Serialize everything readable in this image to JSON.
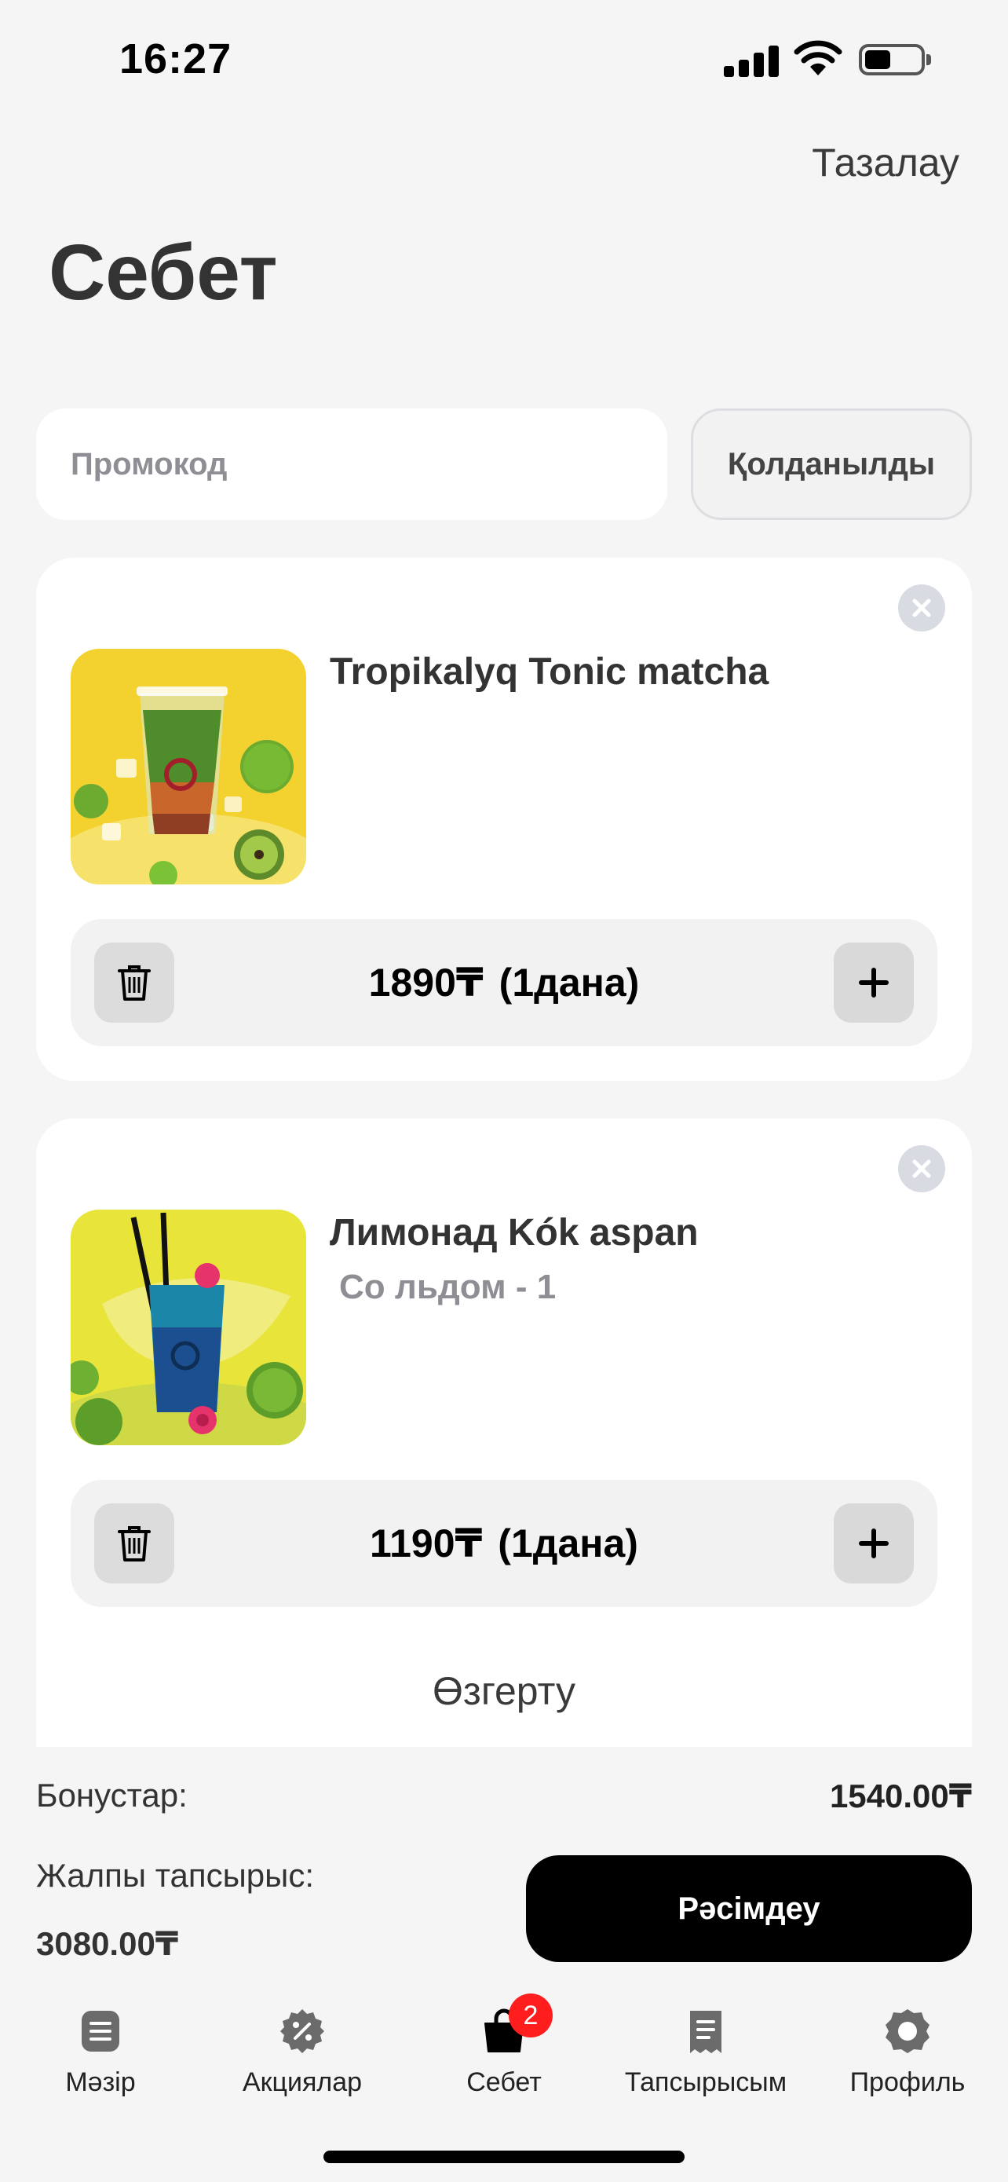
{
  "status_bar": {
    "time": "16:27"
  },
  "header": {
    "clear_label": "Тазалау",
    "title": "Себет"
  },
  "promo": {
    "placeholder": "Промокод",
    "apply_label": "Қолданылды"
  },
  "items": [
    {
      "name": "Tropikalyq Tonic matcha",
      "modifier": "",
      "price": "1890₸",
      "quantity": "(1дана)"
    },
    {
      "name": "Лимонад Kók aspan",
      "modifier": "Со льдом - 1",
      "price": "1190₸",
      "quantity": "(1дана)"
    }
  ],
  "edit_label": "Өзгерту",
  "summary": {
    "bonus_label": "Бонустар:",
    "bonus_value": "1540.00₸",
    "total_label": "Жалпы тапсырыс:",
    "total_value": "3080.00₸",
    "checkout_label": "Рәсімдеу"
  },
  "tab_bar": {
    "tabs": [
      {
        "label": "Мәзір",
        "icon": "menu-list-icon"
      },
      {
        "label": "Акциялар",
        "icon": "promo-percent-icon"
      },
      {
        "label": "Себет",
        "icon": "cart-bag-icon",
        "badge": "2",
        "active": true
      },
      {
        "label": "Тапсырысым",
        "icon": "receipt-icon"
      },
      {
        "label": "Профиль",
        "icon": "profile-icon"
      }
    ]
  },
  "colors": {
    "accent": "#000000",
    "badge": "#ff1d1d",
    "background": "#f5f5f5",
    "muted_text": "#8e8e94"
  }
}
